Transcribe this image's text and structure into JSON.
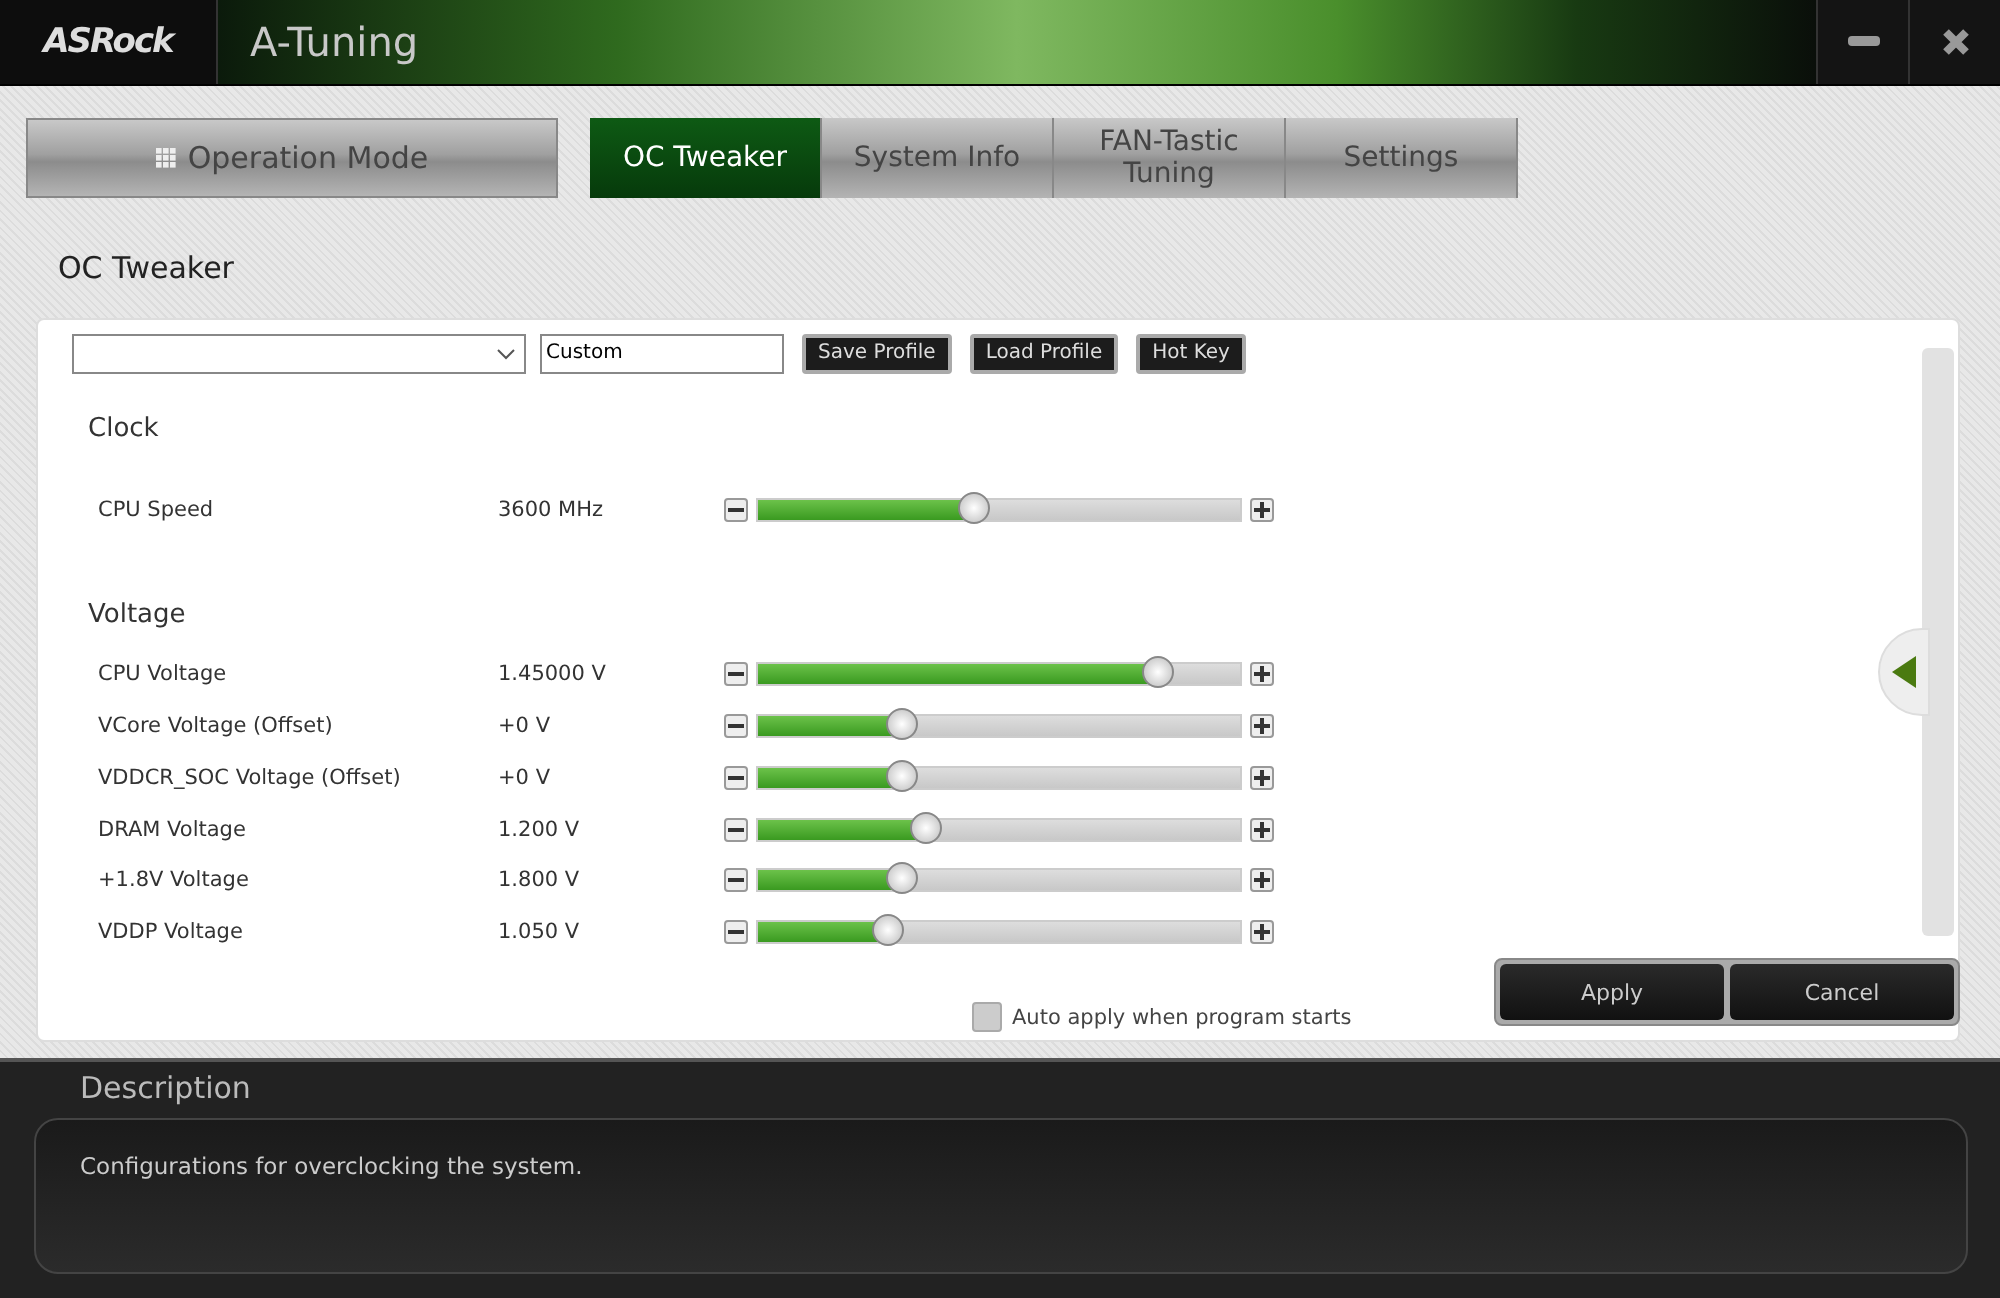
{
  "window": {
    "logo": "ASRock",
    "title": "A-Tuning"
  },
  "mode_button": {
    "label": "Operation Mode"
  },
  "tabs": [
    {
      "label": "OC Tweaker",
      "selected": true
    },
    {
      "label": "System Info",
      "selected": false
    },
    {
      "label": "FAN-Tastic Tuning",
      "selected": false
    },
    {
      "label": "Settings",
      "selected": false
    }
  ],
  "page_title": "OC Tweaker",
  "profile_bar": {
    "profile_value": "Custom",
    "buttons": [
      "Save Profile",
      "Load Profile",
      "Hot Key"
    ]
  },
  "sections": [
    {
      "title": "Clock",
      "rows": [
        {
          "label": "CPU Speed",
          "value": "3600 MHz",
          "level": 0.45
        }
      ]
    },
    {
      "title": "Voltage",
      "rows": [
        {
          "label": "CPU Voltage",
          "value": "1.45000 V",
          "level": 0.83
        },
        {
          "label": "VCore Voltage (Offset)",
          "value": "+0 V",
          "level": 0.3
        },
        {
          "label": "VDDCR_SOC Voltage (Offset)",
          "value": "+0 V",
          "level": 0.3
        },
        {
          "label": "DRAM Voltage",
          "value": "1.200 V",
          "level": 0.35
        },
        {
          "label": "+1.8V Voltage",
          "value": "1.800 V",
          "level": 0.3
        },
        {
          "label": "VDDP Voltage",
          "value": "1.050 V",
          "level": 0.27
        }
      ]
    }
  ],
  "auto_apply": {
    "label": "Auto apply when program starts",
    "checked": false
  },
  "actions": [
    "Apply",
    "Cancel"
  ],
  "description": {
    "title": "Description",
    "text": "Configurations for overclocking the system."
  }
}
